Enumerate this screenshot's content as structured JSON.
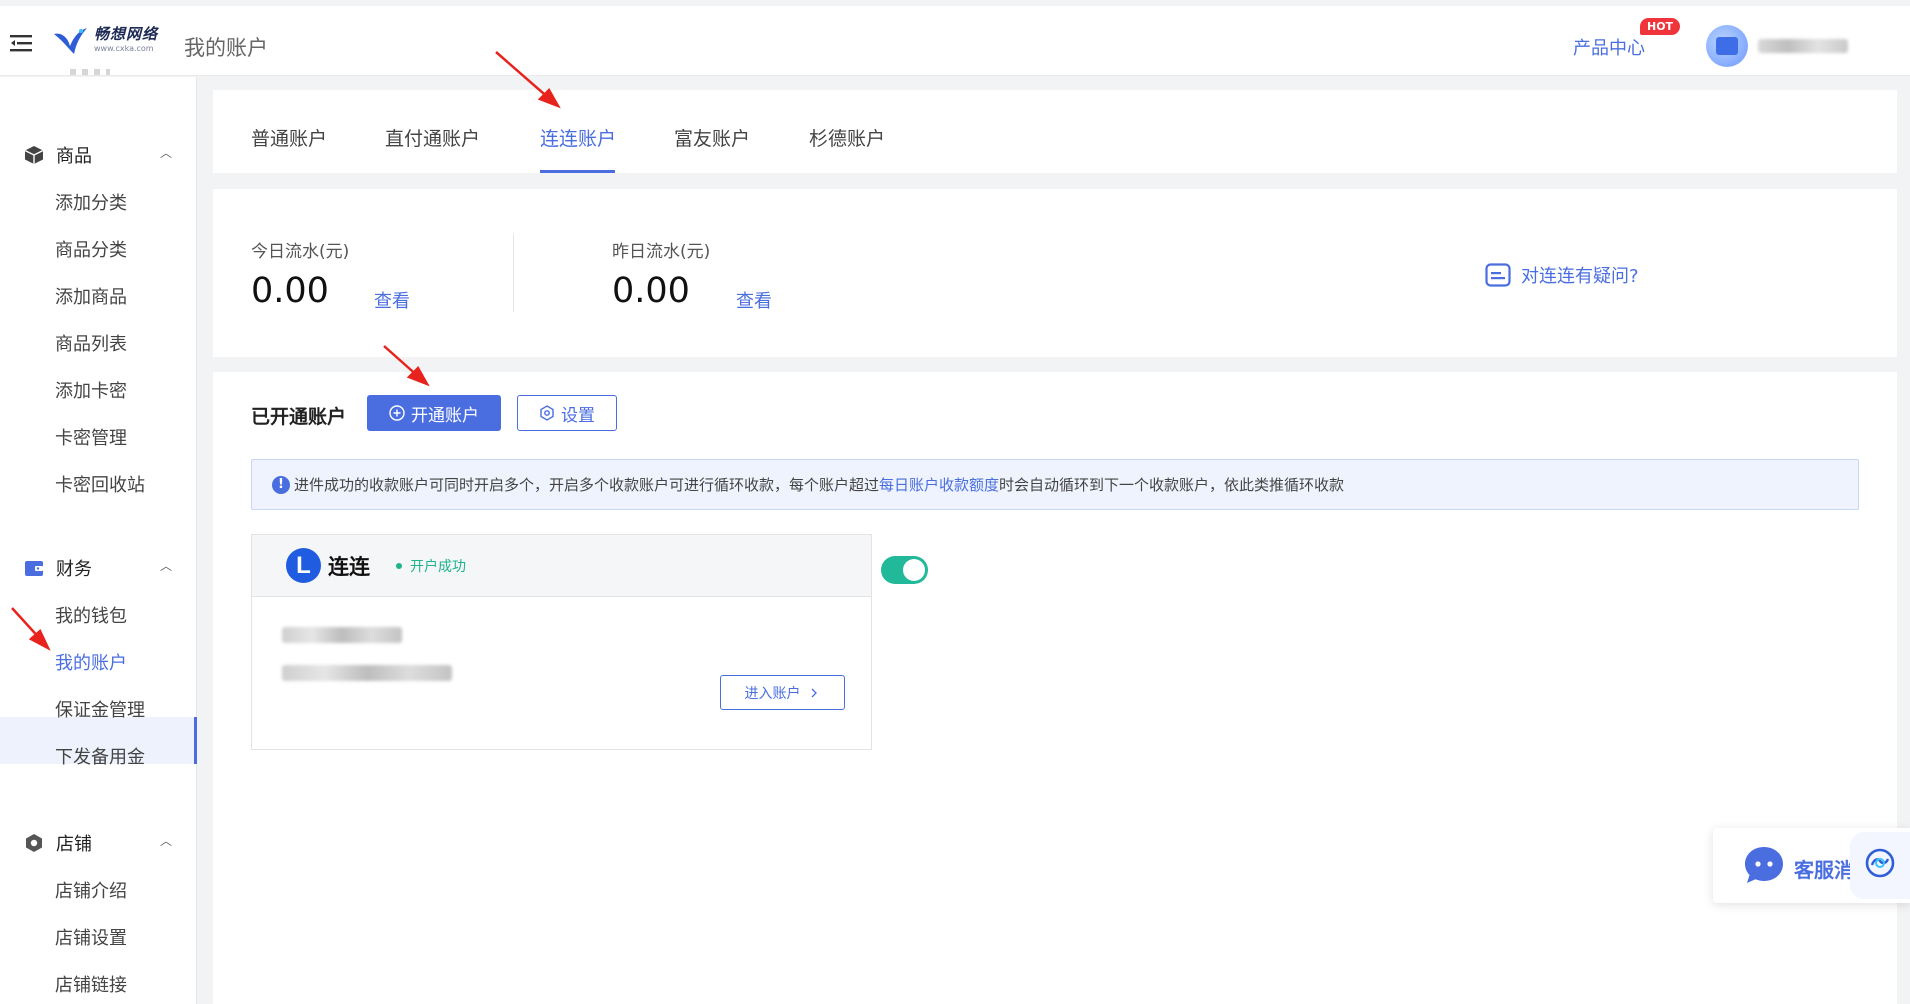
{
  "header": {
    "logo_name": "畅想网络",
    "logo_url": "www.cxka.com",
    "page_title": "我的账户",
    "product_center": "产品中心",
    "hot_badge": "HOT"
  },
  "sidebar": {
    "groups": [
      {
        "label": "商品",
        "icon": "box-icon",
        "items": [
          "添加分类",
          "商品分类",
          "添加商品",
          "商品列表",
          "添加卡密",
          "卡密管理",
          "卡密回收站"
        ]
      },
      {
        "label": "财务",
        "icon": "wallet-icon",
        "items": [
          "我的钱包",
          "我的账户",
          "保证金管理",
          "下发备用金"
        ]
      },
      {
        "label": "店铺",
        "icon": "store-icon",
        "items": [
          "店铺介绍",
          "店铺设置",
          "店铺链接"
        ]
      }
    ],
    "active_item": "我的账户"
  },
  "tabs": [
    "普通账户",
    "直付通账户",
    "连连账户",
    "富友账户",
    "杉德账户"
  ],
  "active_tab": "连连账户",
  "stats": {
    "today_label": "今日流水(元)",
    "today_value": "0.00",
    "yesterday_label": "昨日流水(元)",
    "yesterday_value": "0.00",
    "view_label": "查看",
    "faq": "对连连有疑问?"
  },
  "accounts": {
    "section_title": "已开通账户",
    "open_button": "开通账户",
    "settings_button": "设置",
    "notice_prefix": "进件成功的收款账户可同时开启多个，开启多个收款账户可进行循环收款，每个账户超过",
    "notice_link": "每日账户收款额度",
    "notice_suffix": "时会自动循环到下一个收款账户，依此类推循环收款",
    "card": {
      "logo_letter": "L",
      "name": "连连",
      "status": "开户成功",
      "enter_button": "进入账户",
      "enabled": true
    }
  },
  "customer_service": {
    "label": "客服消"
  },
  "colors": {
    "accent": "#4a6ee0",
    "success": "#1fb48c",
    "toggle_on": "#22b89a",
    "hot": "#f0343c",
    "annotation_arrow": "#e8231e"
  }
}
